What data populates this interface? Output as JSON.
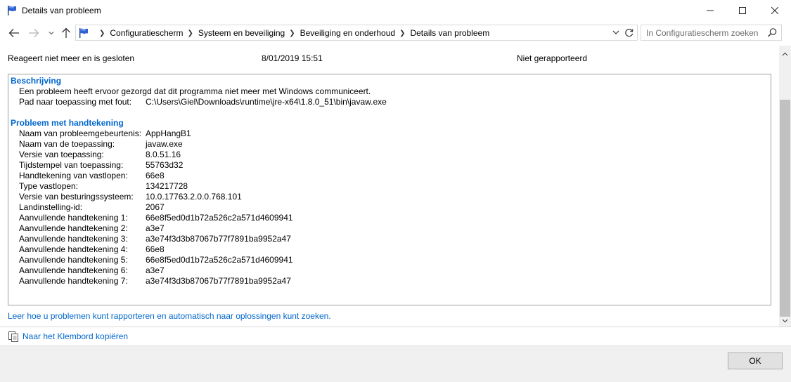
{
  "window": {
    "title": "Details van probleem"
  },
  "address": {
    "crumbs": [
      "Configuratiescherm",
      "Systeem en beveiliging",
      "Beveiliging en onderhoud",
      "Details van probleem"
    ]
  },
  "search": {
    "placeholder": "In Configuratiescherm zoeken"
  },
  "summary": {
    "status": "Reageert niet meer en is gesloten",
    "datetime": "8/01/2019 15:51",
    "report_status": "Niet gerapporteerd"
  },
  "description": {
    "heading": "Beschrijving",
    "text": "Een probleem heeft ervoor gezorgd dat dit programma niet meer met Windows communiceert.",
    "path_label": "Pad naar toepassing met fout:",
    "path_value": "C:\\Users\\Giel\\Downloads\\runtime\\jre-x64\\1.8.0_51\\bin\\javaw.exe"
  },
  "signature": {
    "heading": "Probleem met handtekening",
    "rows": [
      {
        "label": "Naam van probleemgebeurtenis:",
        "value": "AppHangB1"
      },
      {
        "label": "Naam van de toepassing:",
        "value": "javaw.exe"
      },
      {
        "label": "Versie van toepassing:",
        "value": "8.0.51.16"
      },
      {
        "label": "Tijdstempel van toepassing:",
        "value": "55763d32"
      },
      {
        "label": "Handtekening van vastlopen:",
        "value": "66e8"
      },
      {
        "label": "Type vastlopen:",
        "value": "134217728"
      },
      {
        "label": "Versie van besturingssysteem:",
        "value": "10.0.17763.2.0.0.768.101"
      },
      {
        "label": "Landinstelling-id:",
        "value": "2067"
      },
      {
        "label": "Aanvullende handtekening 1:",
        "value": "66e8f5ed0d1b72a526c2a571d4609941"
      },
      {
        "label": "Aanvullende handtekening 2:",
        "value": "a3e7"
      },
      {
        "label": "Aanvullende handtekening 3:",
        "value": "a3e74f3d3b87067b77f7891ba9952a47"
      },
      {
        "label": "Aanvullende handtekening 4:",
        "value": "66e8"
      },
      {
        "label": "Aanvullende handtekening 5:",
        "value": "66e8f5ed0d1b72a526c2a571d4609941"
      },
      {
        "label": "Aanvullende handtekening 6:",
        "value": "a3e7"
      },
      {
        "label": "Aanvullende handtekening 7:",
        "value": "a3e74f3d3b87067b77f7891ba9952a47"
      }
    ]
  },
  "links": {
    "help": "Leer hoe u problemen kunt rapporteren en automatisch naar oplossingen kunt zoeken.",
    "copy": "Naar het Klembord kopiëren"
  },
  "buttons": {
    "ok": "OK"
  },
  "colors": {
    "link": "#0066cc",
    "footer_bg": "#f0f0f0"
  }
}
